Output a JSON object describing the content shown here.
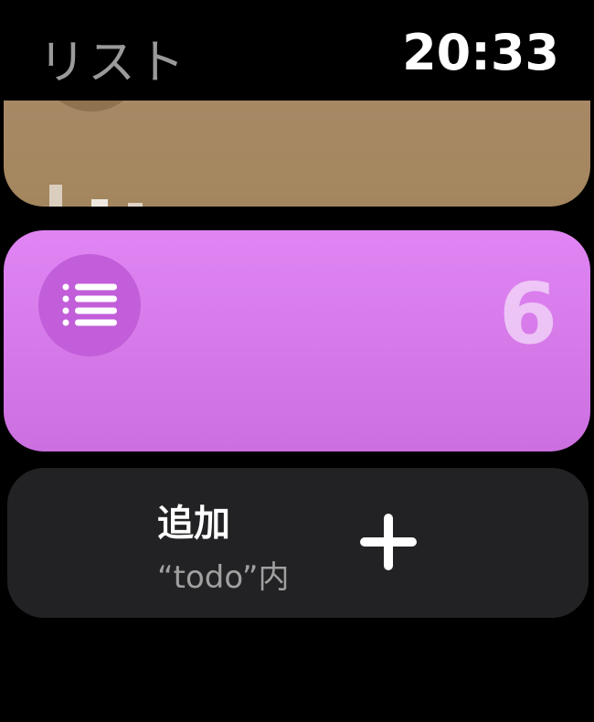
{
  "header": {
    "title": "リスト",
    "time": "20:33"
  },
  "lists": [
    {
      "name": "",
      "color": "#a88a68"
    },
    {
      "name": "",
      "color": "#dd80f0",
      "count": "6",
      "icon": "list-bullet-icon"
    }
  ],
  "add_card": {
    "title": "追加",
    "subtitle": "“todo”内",
    "icon": "plus-icon"
  },
  "colors": {
    "background": "#000000",
    "tan_card": "#a88a68",
    "purple_card": "#dd80f0",
    "purple_icon_bg": "#c25ed9",
    "add_card": "#222224",
    "title_gray": "#9a9a9a"
  }
}
